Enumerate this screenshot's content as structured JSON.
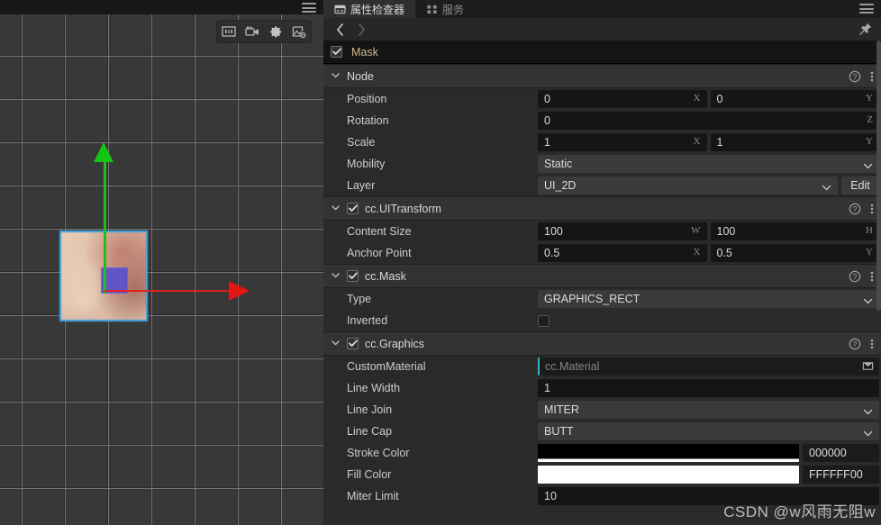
{
  "scene": {
    "menu_icon": "hamburger-icon",
    "toolbar": [
      {
        "name": "scale-1-1-icon",
        "label": "1:1"
      },
      {
        "name": "camera-icon",
        "label": "Camera"
      },
      {
        "name": "gear-icon",
        "label": "Settings"
      },
      {
        "name": "image-settings-icon",
        "label": "Image Settings"
      }
    ],
    "gizmo": {
      "y_axis_color": "#16c416",
      "x_axis_color": "#e41515",
      "selection_color": "#3ba7e8"
    },
    "grid": {
      "spacing": 48,
      "line_color": "#ffffff4d"
    }
  },
  "inspector": {
    "tabs": [
      {
        "label": "属性检查器",
        "icon": "inspector-icon",
        "active": true
      },
      {
        "label": "服务",
        "icon": "services-icon",
        "active": false
      }
    ],
    "menu_icon": "hamburger-icon",
    "nav": {
      "back": "‹",
      "forward": "›",
      "pin": "pin-icon"
    },
    "node": {
      "name": "Mask",
      "enabled": true
    },
    "sections": [
      {
        "id": "node",
        "title": "Node",
        "has_checkbox": false,
        "expanded": true,
        "rows": [
          {
            "type": "vec2",
            "label": "Position",
            "x": "0",
            "y": "0",
            "ax1": "X",
            "ax2": "Y"
          },
          {
            "type": "vec1",
            "label": "Rotation",
            "x": "0",
            "ax1": "Z"
          },
          {
            "type": "vec2",
            "label": "Scale",
            "x": "1",
            "y": "1",
            "ax1": "X",
            "ax2": "Y"
          },
          {
            "type": "select",
            "label": "Mobility",
            "value": "Static"
          },
          {
            "type": "select-edit",
            "label": "Layer",
            "value": "UI_2D",
            "button": "Edit"
          }
        ]
      },
      {
        "id": "uitransform",
        "title": "cc.UITransform",
        "has_checkbox": true,
        "checked": true,
        "expanded": true,
        "rows": [
          {
            "type": "vec2",
            "label": "Content Size",
            "x": "100",
            "y": "100",
            "ax1": "W",
            "ax2": "H"
          },
          {
            "type": "vec2",
            "label": "Anchor Point",
            "x": "0.5",
            "y": "0.5",
            "ax1": "X",
            "ax2": "Y"
          }
        ]
      },
      {
        "id": "mask",
        "title": "cc.Mask",
        "has_checkbox": true,
        "checked": true,
        "expanded": true,
        "rows": [
          {
            "type": "select",
            "label": "Type",
            "value": "GRAPHICS_RECT"
          },
          {
            "type": "checkbox",
            "label": "Inverted",
            "checked": false
          }
        ]
      },
      {
        "id": "graphics",
        "title": "cc.Graphics",
        "has_checkbox": true,
        "checked": true,
        "expanded": true,
        "rows": [
          {
            "type": "asset",
            "label": "CustomMaterial",
            "placeholder": "cc.Material"
          },
          {
            "type": "vec1-plain",
            "label": "Line Width",
            "x": "1"
          },
          {
            "type": "select",
            "label": "Line Join",
            "value": "MITER"
          },
          {
            "type": "select",
            "label": "Line Cap",
            "value": "BUTT"
          },
          {
            "type": "color",
            "label": "Stroke Color",
            "hex": "000000",
            "swatch": "stroke"
          },
          {
            "type": "color",
            "label": "Fill Color",
            "hex": "FFFFFF00",
            "swatch": "fill"
          },
          {
            "type": "vec1-plain",
            "label": "Miter Limit",
            "x": "10"
          }
        ]
      }
    ],
    "help_icon": "help-circle-icon",
    "more_icon": "more-vertical-icon"
  },
  "watermark": "CSDN @w风雨无阻w",
  "colors": {
    "accent_cyan": "#2fb8c8",
    "node_name": "#d3b78a",
    "panel_bg": "#2a2a2a",
    "section_header_bg": "#333333"
  }
}
